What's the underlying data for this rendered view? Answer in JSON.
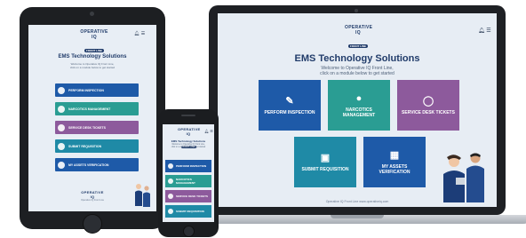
{
  "brand": {
    "logo_text": "OPERATIVE IQ",
    "logo_tagline": "FRONT LINE"
  },
  "colors": {
    "blue": "#1e5aa8",
    "teal": "#2a9d93",
    "purple": "#8d5a9c",
    "cyan": "#1f8aa6",
    "navy": "#213c6a"
  },
  "header_icons": [
    "bell-icon",
    "menu-icon"
  ],
  "laptop": {
    "title": "EMS Technology Solutions",
    "subtitle": "Welcome to Operative IQ Front Line,",
    "subtitle2": "click on a module below to get started",
    "tiles": [
      {
        "label": "PERFORM INSPECTION",
        "icon": "clipboard-edit-icon"
      },
      {
        "label": "NARCOTICS MANAGEMENT",
        "icon": "pills-icon"
      },
      {
        "label": "SERVICE DESK TICKETS",
        "icon": "service-desk-icon"
      },
      {
        "label": "SUBMIT REQUISITION",
        "icon": "cart-icon"
      },
      {
        "label": "MY ASSETS VERIFICATION",
        "icon": "box-icon"
      }
    ],
    "footer": "Operative IQ Front Line www.operativeiq.com"
  },
  "tablet": {
    "title": "EMS Technology Solutions",
    "subtitle": "Welcome to Operative IQ Front Line,",
    "subtitle2": "click on a module below to get started",
    "buttons": [
      {
        "label": "PERFORM INSPECTION"
      },
      {
        "label": "NARCOTICS MANAGEMENT"
      },
      {
        "label": "SERVICE DESK TICKETS"
      },
      {
        "label": "SUBMIT REQUISITION"
      },
      {
        "label": "MY ASSETS VERIFICATION"
      }
    ],
    "footer": "Operative IQ Front Line"
  },
  "phone": {
    "buttons": [
      {
        "label": "PERFORM INSPECTION"
      },
      {
        "label": "NARCOTICS MANAGEMENT"
      },
      {
        "label": "SERVICE DESK TICKETS"
      },
      {
        "label": "SUBMIT REQUISITION"
      }
    ]
  }
}
